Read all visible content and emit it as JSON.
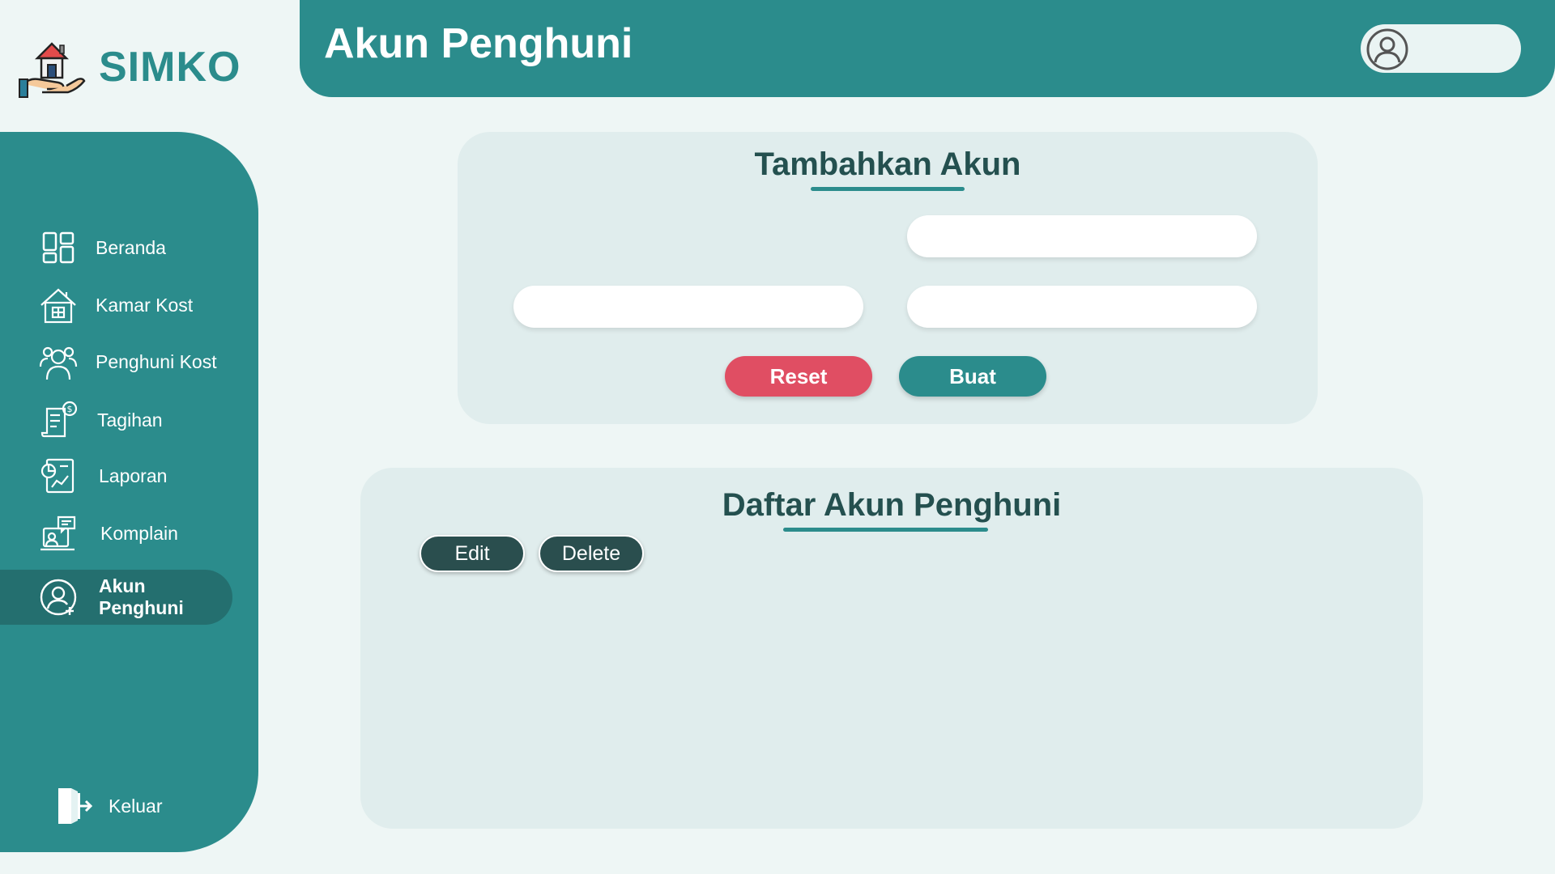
{
  "app": {
    "name": "SIMKO",
    "logo_icon": "house-hand-icon"
  },
  "header": {
    "title": "Akun Penghuni",
    "user_icon": "user-avatar-icon"
  },
  "sidebar": {
    "items": [
      {
        "label": "Beranda",
        "icon": "dashboard-icon"
      },
      {
        "label": "Kamar Kost",
        "icon": "house-icon"
      },
      {
        "label": "Penghuni Kost",
        "icon": "people-icon"
      },
      {
        "label": "Tagihan",
        "icon": "bill-icon"
      },
      {
        "label": "Laporan",
        "icon": "report-icon"
      },
      {
        "label": "Komplain",
        "icon": "complaint-icon"
      },
      {
        "label": "Akun Penghuni",
        "icon": "user-add-icon",
        "active": true
      }
    ],
    "logout": {
      "label": "Keluar",
      "icon": "logout-door-icon"
    }
  },
  "form": {
    "title": "Tambahkan Akun",
    "fields": [
      {
        "value": "",
        "placeholder": ""
      },
      {
        "value": "",
        "placeholder": ""
      },
      {
        "value": "",
        "placeholder": ""
      }
    ],
    "reset_label": "Reset",
    "submit_label": "Buat"
  },
  "list": {
    "title": "Daftar Akun Penghuni",
    "edit_label": "Edit",
    "delete_label": "Delete"
  },
  "colors": {
    "primary": "#2b8c8c",
    "primary_dark": "#246f6f",
    "background": "#eef6f5",
    "card": "#e0eded",
    "danger": "#e04e63",
    "title_text": "#24504f",
    "dark_button": "#2a4e4e"
  }
}
